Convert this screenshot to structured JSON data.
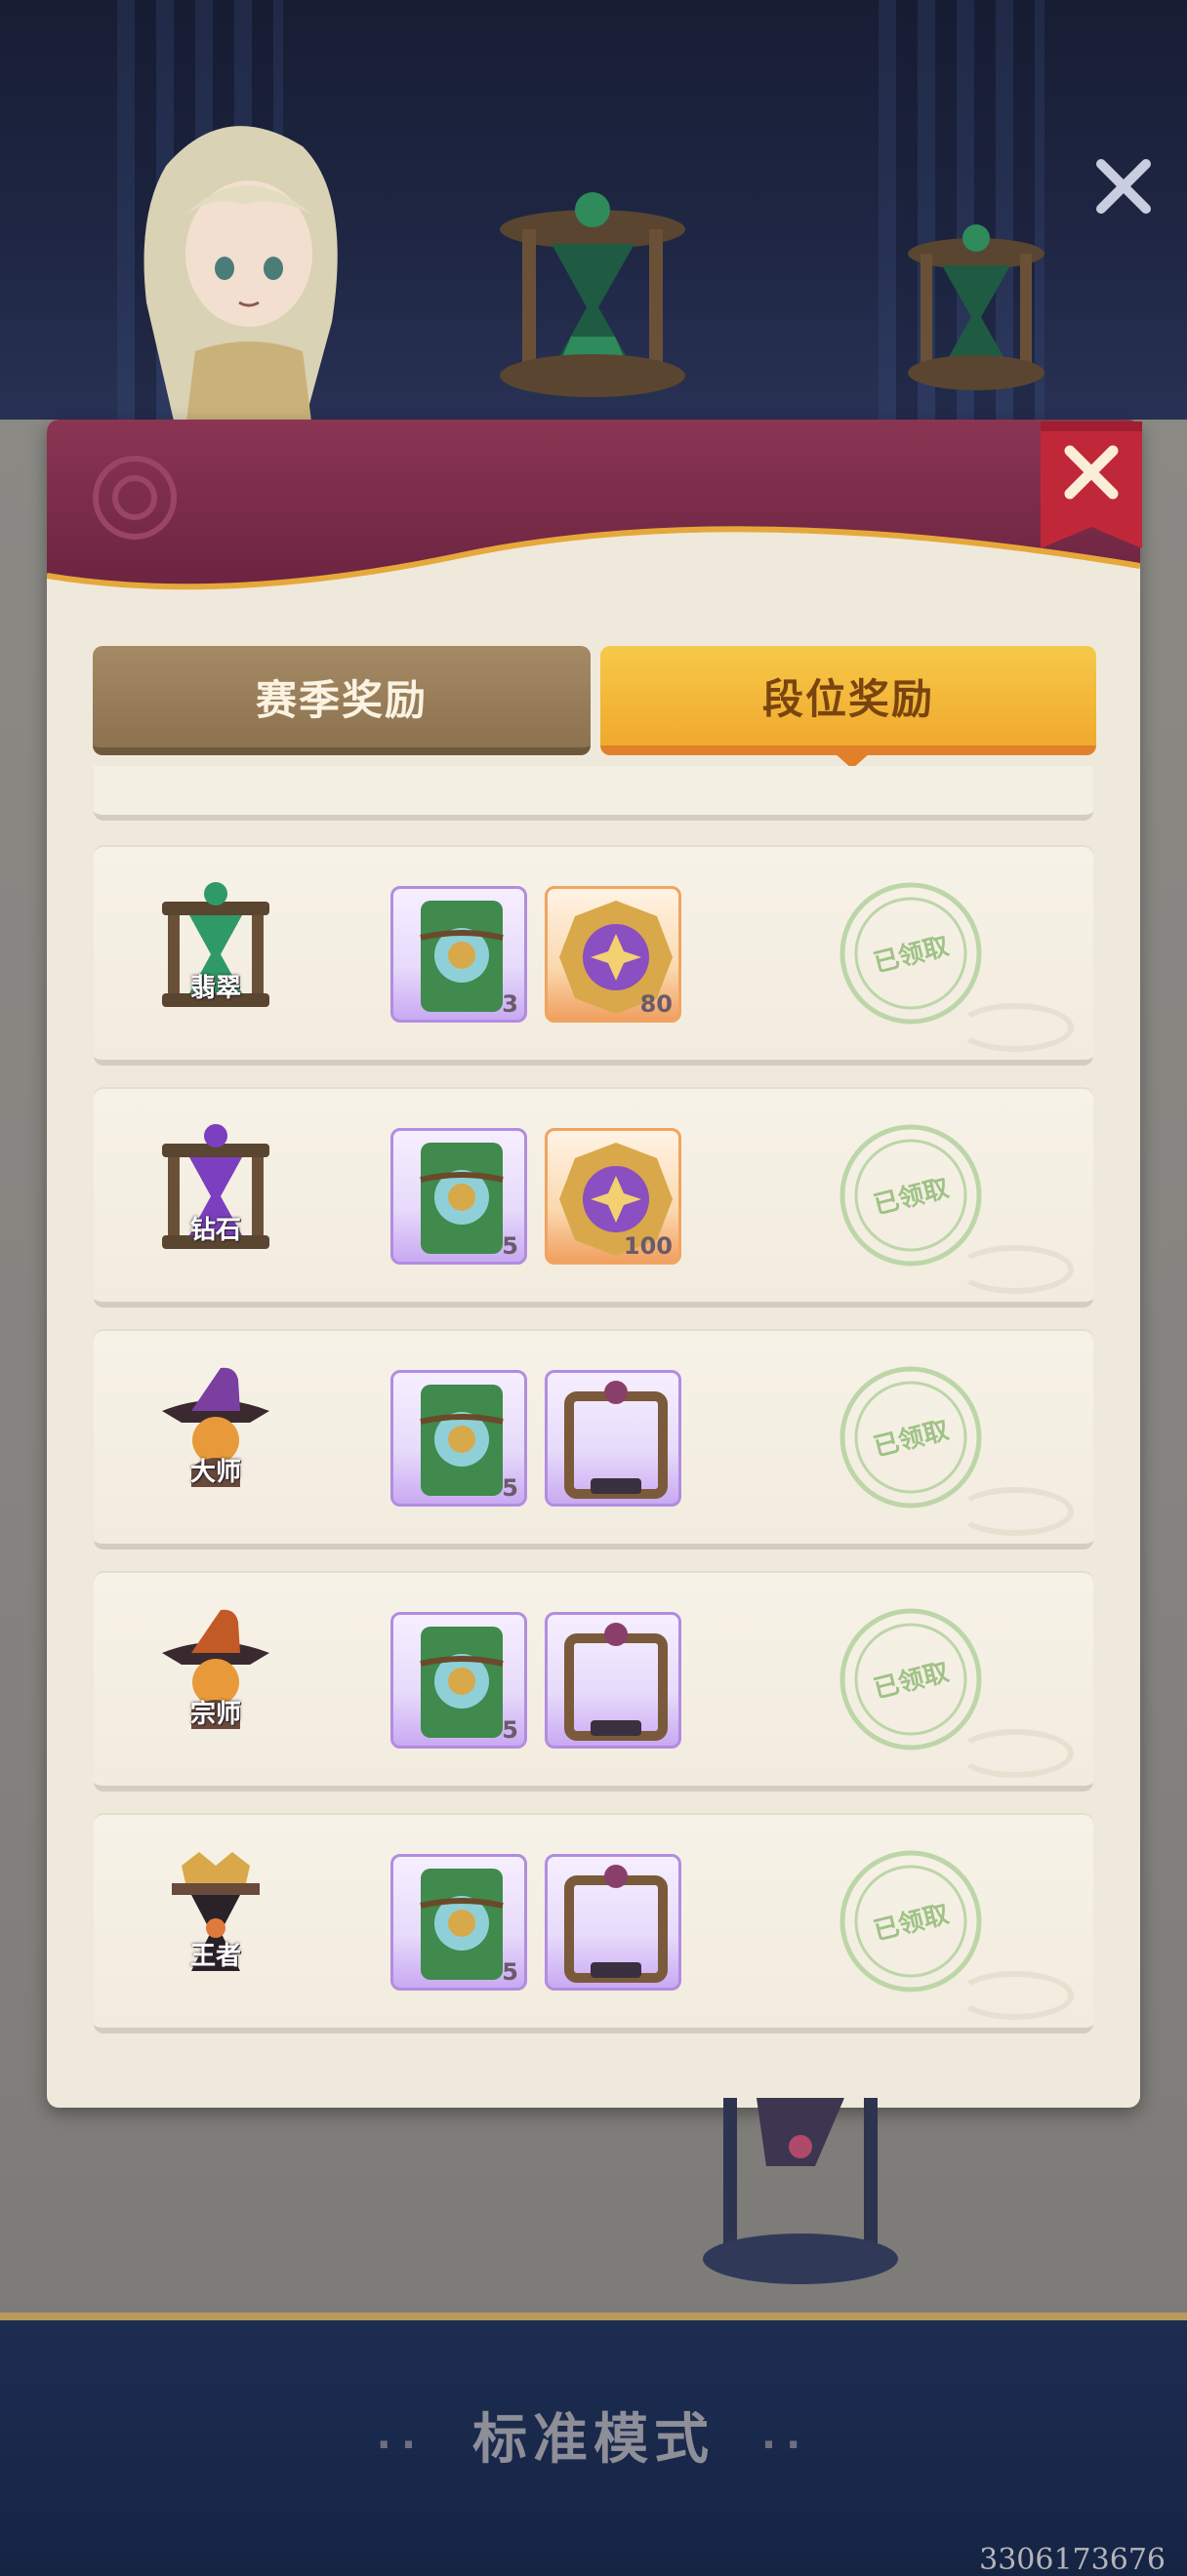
{
  "header": {
    "tabs": [
      {
        "label": "赛季奖励",
        "selected": false
      },
      {
        "label": "段位奖励",
        "selected": true
      }
    ]
  },
  "ranks": [
    {
      "name": "翡翠",
      "color": "#2f9a66",
      "rewards": [
        {
          "icon": "card-pack-icon",
          "qty": "3"
        },
        {
          "icon": "gold-coin-icon",
          "qty": "80"
        }
      ],
      "status": "已领取"
    },
    {
      "name": "钻石",
      "color": "#7b3fbf",
      "rewards": [
        {
          "icon": "card-pack-icon",
          "qty": "5"
        },
        {
          "icon": "gold-coin-icon",
          "qty": "100"
        }
      ],
      "status": "已领取"
    },
    {
      "name": "大师",
      "color": "#7a3fa0",
      "rewards": [
        {
          "icon": "card-pack-icon",
          "qty": "5"
        },
        {
          "icon": "avatar-frame-icon",
          "qty": ""
        }
      ],
      "status": "已领取"
    },
    {
      "name": "宗师",
      "color": "#c25a28",
      "rewards": [
        {
          "icon": "card-pack-icon",
          "qty": "5"
        },
        {
          "icon": "avatar-frame-icon",
          "qty": ""
        }
      ],
      "status": "已领取"
    },
    {
      "name": "王者",
      "color": "#b8873a",
      "rewards": [
        {
          "icon": "card-pack-icon",
          "qty": "5"
        },
        {
          "icon": "avatar-frame-icon",
          "qty": ""
        }
      ],
      "status": "已领取"
    }
  ],
  "footer": {
    "mode_title": "标准模式",
    "id_text": "3306173676"
  },
  "colors": {
    "panel_header": "#7c2d4a",
    "tab_active": "#f3b43a",
    "tab_inactive": "#9a8060",
    "stamp": "#9fc286"
  }
}
